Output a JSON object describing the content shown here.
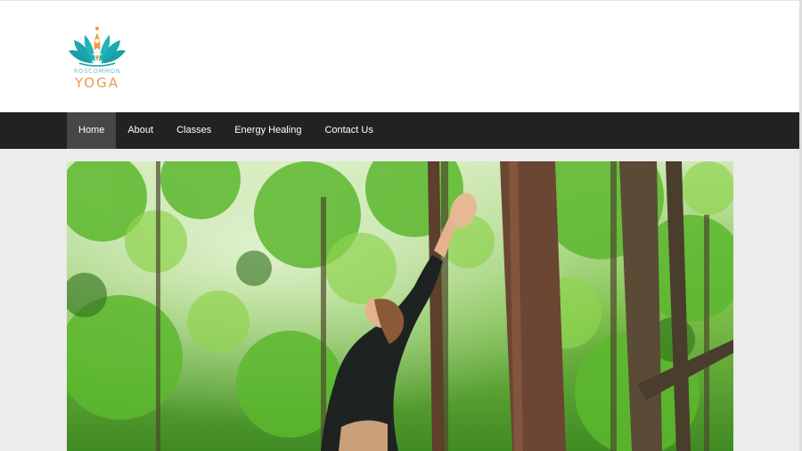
{
  "logo": {
    "small_text": "ROSCOMMON",
    "big_text": "YOGA",
    "icon": "lotus-meditation-icon",
    "colors": {
      "teal": "#1aa1a6",
      "orange": "#e99b4a"
    }
  },
  "nav": {
    "items": [
      {
        "label": "Home",
        "active": true
      },
      {
        "label": "About"
      },
      {
        "label": "Classes"
      },
      {
        "label": "Energy Healing"
      },
      {
        "label": "Contact Us"
      }
    ]
  },
  "hero": {
    "description_icon": "forest-yoga-photo"
  }
}
